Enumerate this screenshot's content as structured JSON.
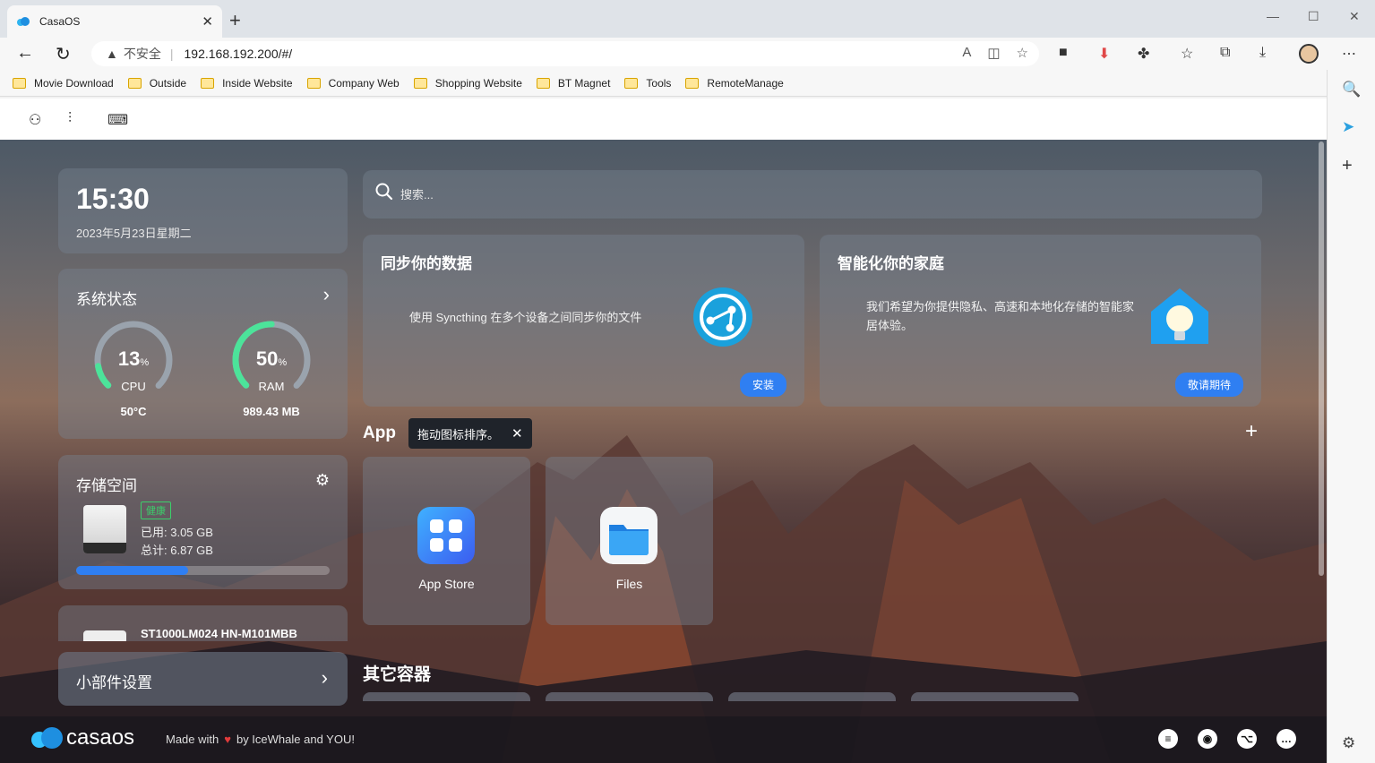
{
  "browser": {
    "tab_title": "CasaOS",
    "insecure_label": "不安全",
    "url": "192.168.192.200/#/",
    "bookmarks": [
      "Movie Download",
      "Outside",
      "Inside Website",
      "Company Web",
      "Shopping Website",
      "BT Magnet",
      "Tools",
      "RemoteManage"
    ]
  },
  "clock": {
    "time": "15:30",
    "date": "2023年5月23日星期二"
  },
  "system": {
    "title": "系统状态",
    "cpu": {
      "value": "13",
      "unit": "%",
      "label": "CPU",
      "sub": "50°C",
      "percent": 13
    },
    "ram": {
      "value": "50",
      "unit": "%",
      "label": "RAM",
      "sub": "989.43 MB",
      "percent": 50
    }
  },
  "storage": {
    "title": "存储空间",
    "badge": "健康",
    "used": "已用: 3.05 GB",
    "total": "总计: 6.87 GB",
    "used_fraction": 0.44,
    "disk2_name": "ST1000LM024 HN-M101MBB"
  },
  "widget_settings": "小部件设置",
  "search": {
    "placeholder": "搜索..."
  },
  "promos": [
    {
      "title": "同步你的数据",
      "desc": "使用 Syncthing 在多个设备之间同步你的文件",
      "button": "安装"
    },
    {
      "title": "智能化你的家庭",
      "desc": "我们希望为你提供隐私、高速和本地化存储的智能家居体验。",
      "button": "敬请期待"
    }
  ],
  "apps": {
    "label": "App",
    "tooltip": "拖动图标排序。",
    "items": [
      {
        "name": "App Store",
        "icon": "app-store-icon"
      },
      {
        "name": "Files",
        "icon": "files-folder-icon"
      }
    ]
  },
  "other_containers": {
    "label": "其它容器"
  },
  "footer": {
    "logo_text": "casaos",
    "made_with": "Made with",
    "by": "by IceWhale and YOU!"
  },
  "colors": {
    "accent": "#2f7ff2",
    "healthy": "#3ccf6b",
    "cpu_ring": "#4ce39a",
    "heart": "#e23b3b"
  }
}
